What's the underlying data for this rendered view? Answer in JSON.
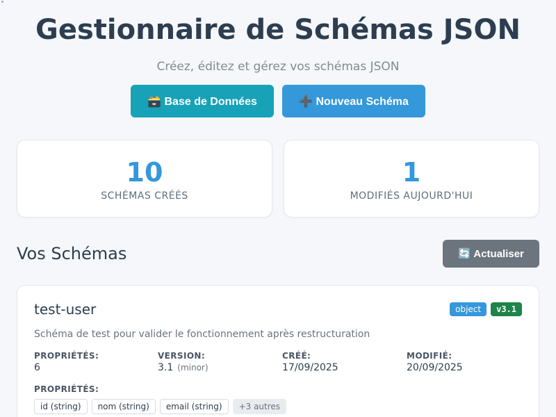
{
  "header": {
    "title": "Gestionnaire de Schémas JSON",
    "subtitle": "Créez, éditez et gérez vos schémas JSON",
    "database_button": "🗃️ Base de Données",
    "new_schema_button": "➕ Nouveau Schéma"
  },
  "stats": [
    {
      "value": "10",
      "label": "SCHÉMAS CRÉÉS"
    },
    {
      "value": "1",
      "label": "MODIFIÉS AUJOURD'HUI"
    }
  ],
  "schemas_section": {
    "title": "Vos Schémas",
    "refresh_button": "🔄 Actualiser"
  },
  "schema_card": {
    "name": "test-user",
    "type_badge": "object",
    "version_badge": "v3.1",
    "description": "Schéma de test pour valider le fonctionnement après restructuration",
    "properties_label": "PROPRIÉTÉS:",
    "properties_value": "6",
    "version_label": "VERSION:",
    "version_value": "3.1",
    "version_note": "(minor)",
    "created_label": "CRÉÉ:",
    "created_value": "17/09/2025",
    "modified_label": "MODIFIÉ:",
    "modified_value": "20/09/2025",
    "property_list_label": "PROPRIÉTÉS:",
    "property_tags": [
      "id (string)",
      "nom (string)",
      "email (string)"
    ],
    "more_tag": "+3 autres"
  },
  "colors": {
    "accent_blue": "#3498db",
    "teal": "#17a2b8",
    "gray_button": "#6c757d",
    "version_green": "#1e8449"
  }
}
